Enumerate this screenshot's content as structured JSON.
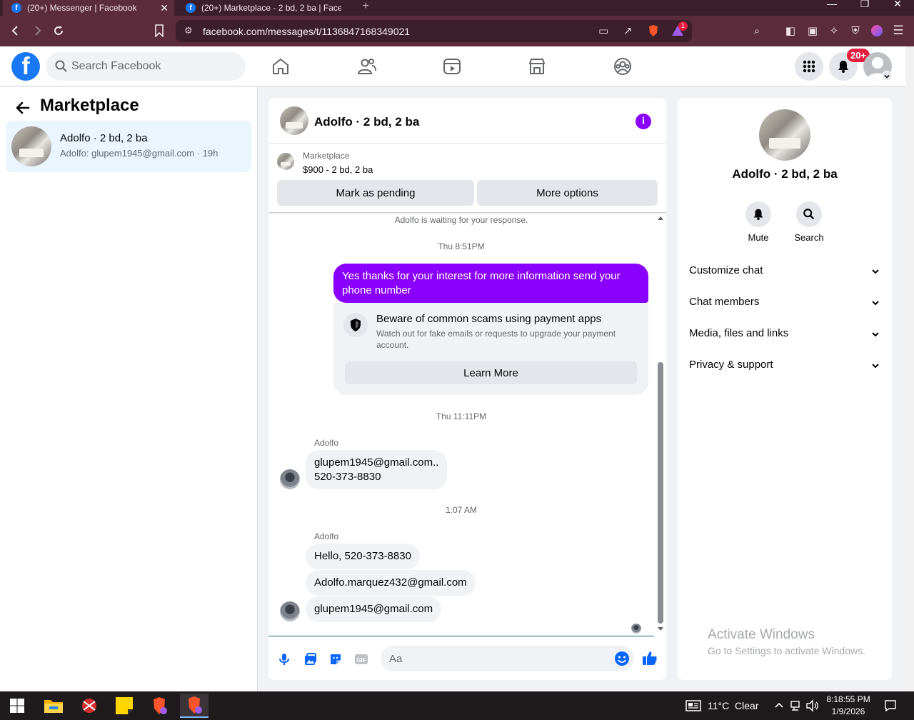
{
  "browser": {
    "tabs": [
      {
        "title": "(20+) Messenger | Facebook",
        "active": true
      },
      {
        "title": "(20+) Marketplace - 2 bd, 2 ba | Facel",
        "active": false
      }
    ],
    "new_tab": "+",
    "url": "facebook.com/messages/t/1136847168349021",
    "extension_badge": "1",
    "window_controls": [
      "—",
      "❐",
      "✕"
    ]
  },
  "fb_header": {
    "logo": "f",
    "search_placeholder": "Search Facebook",
    "nav_icons": [
      "home-icon",
      "friends-icon",
      "video-icon",
      "marketplace-icon",
      "groups-icon"
    ],
    "notification_badge": "20+"
  },
  "left_panel": {
    "title": "Marketplace",
    "conversation": {
      "name": "Adolfo · 2 bd, 2 ba",
      "preview": "Adolfo: glupem1945@gmail.com · 19h"
    }
  },
  "chat": {
    "header_name": "Adolfo · 2 bd, 2 ba",
    "marketplace_label": "Marketplace",
    "listing": "$900 - 2 bd, 2 ba",
    "mark_pending": "Mark as pending",
    "more_options": "More options",
    "waiting_notice": "Adolfo is waiting for your response.",
    "timestamps": [
      "Thu 8:51PM",
      "Thu 11:11PM",
      "1:07 AM"
    ],
    "outgoing_message": "Yes thanks for your interest for more information send your phone number",
    "scam_card": {
      "title": "Beware of common scams using payment apps",
      "body": "Watch out for fake emails or requests to upgrade your payment account.",
      "button": "Learn More"
    },
    "sender": "Adolfo",
    "group1": [
      "glupem1945@gmail.com..",
      "520-373-8830"
    ],
    "group2": [
      "Hello, 520-373-8830",
      "Adolfo.marquez432@gmail.com",
      "glupem1945@gmail.com"
    ],
    "composer_placeholder": "Aa"
  },
  "right_panel": {
    "name": "Adolfo · 2 bd, 2 ba",
    "actions": [
      "Mute",
      "Search"
    ],
    "sections": [
      "Customize chat",
      "Chat members",
      "Media, files and links",
      "Privacy & support"
    ]
  },
  "watermark": {
    "line1": "Activate Windows",
    "line2": "Go to Settings to activate Windows."
  },
  "taskbar": {
    "weather": "11°C  Clear",
    "time": "8:18:55 PM",
    "date": "1/9/2026"
  },
  "colors": {
    "brand": "#1877f2",
    "accent": "#8a00ff",
    "chrome": "#5a2c3c",
    "badge": "#e41e3f"
  }
}
